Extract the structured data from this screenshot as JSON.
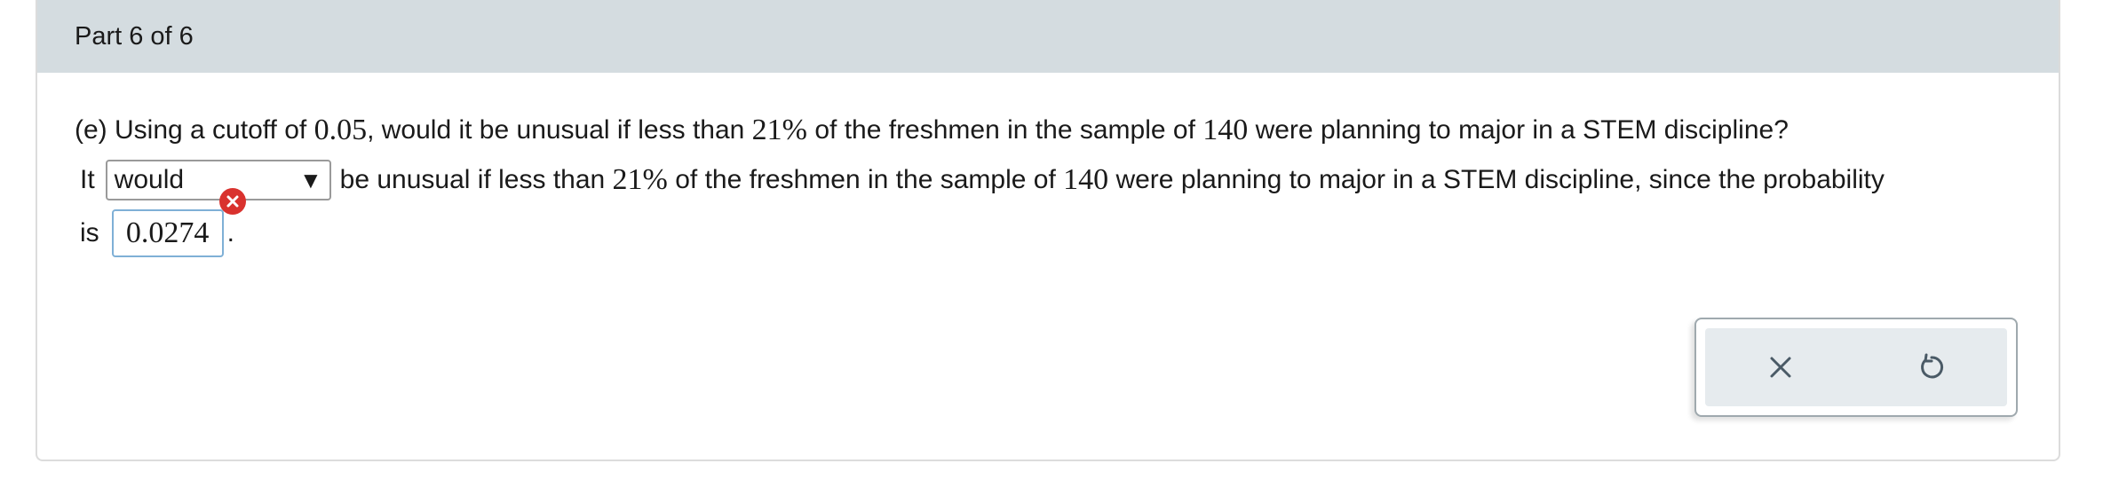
{
  "header": {
    "part_label": "Part 6 of 6"
  },
  "question": {
    "prefix": "(e) Using a cutoff of ",
    "cutoff": "0.05",
    "mid1": ", would it be unusual if less than ",
    "percent": "21%",
    "mid2": " of the freshmen in the sample of ",
    "sample": "140",
    "suffix": " were planning to major in a STEM discipline?"
  },
  "answer_line": {
    "start": "It",
    "dropdown_value": "would",
    "dropdown_arrow": "▼",
    "after1": "be unusual if less than ",
    "percent": "21%",
    "after2": " of the freshmen in the sample of ",
    "sample": "140",
    "after3": " were planning to major in a STEM discipline, since the probability"
  },
  "probability_line": {
    "start": "is",
    "answer_value": "0.0274",
    "end": "."
  },
  "status": {
    "error_color": "#d9322e",
    "input_border_color": "#7fb0d6"
  },
  "toolbar": {
    "clear_icon": "close-icon",
    "undo_icon": "undo-icon"
  }
}
